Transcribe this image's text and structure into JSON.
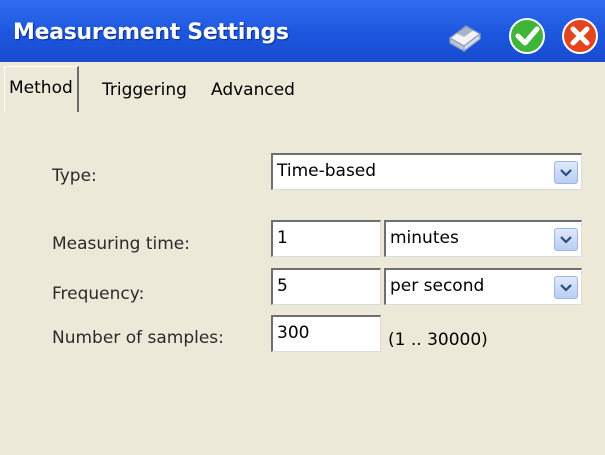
{
  "window": {
    "title": "Measurement Settings",
    "icons": [
      "eraser-icon",
      "checkmark-icon",
      "close-icon"
    ]
  },
  "tabs": [
    {
      "label": "Method",
      "active": true
    },
    {
      "label": "Triggering",
      "active": false
    },
    {
      "label": "Advanced",
      "active": false
    }
  ],
  "form": {
    "type": {
      "label": "Type:",
      "value": "Time-based"
    },
    "measuring_time": {
      "label": "Measuring time:",
      "value": "1",
      "unit": "minutes"
    },
    "frequency": {
      "label": "Frequency:",
      "value": "5",
      "unit": "per second"
    },
    "samples": {
      "label": "Number of samples:",
      "value": "300",
      "range": "(1 .. 30000)"
    }
  },
  "colors": {
    "titlebar": "#1c55dd",
    "panel": "#ece9d8",
    "ok_green": "#3fb53a",
    "close_red": "#e2461f"
  }
}
